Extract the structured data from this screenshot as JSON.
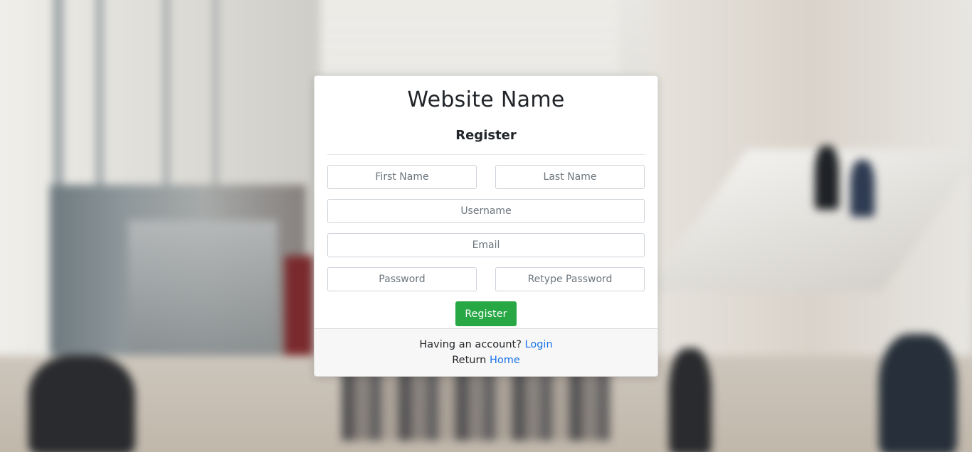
{
  "site_name": "Website Name",
  "page_title": "Register",
  "form": {
    "first_name": {
      "placeholder": "First Name",
      "value": ""
    },
    "last_name": {
      "placeholder": "Last Name",
      "value": ""
    },
    "username": {
      "placeholder": "Username",
      "value": ""
    },
    "email": {
      "placeholder": "Email",
      "value": ""
    },
    "password": {
      "placeholder": "Password",
      "value": ""
    },
    "retype_password": {
      "placeholder": "Retype Password",
      "value": ""
    },
    "submit_label": "Register"
  },
  "footer": {
    "login_prompt": "Having an account?",
    "login_link": "Login",
    "return_prompt": "Return",
    "home_link": "Home"
  },
  "colors": {
    "submit_button": "#28a745",
    "link": "#1a73e8",
    "footer_bg": "#f7f7f7"
  }
}
